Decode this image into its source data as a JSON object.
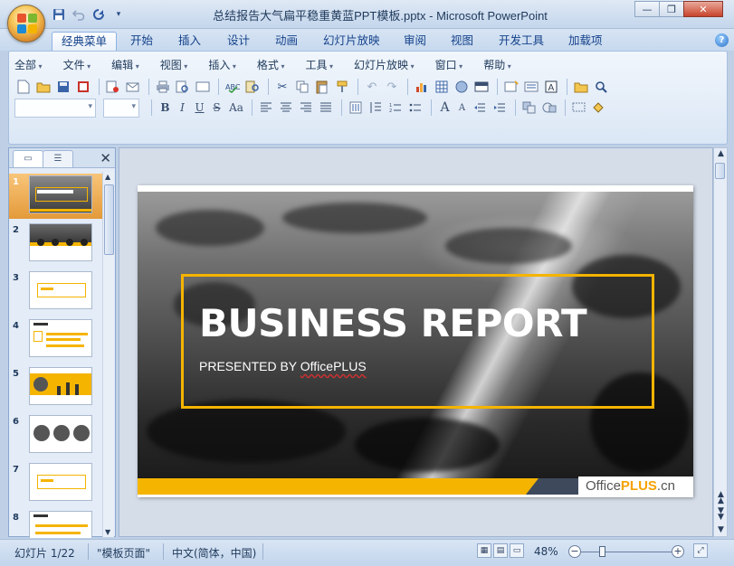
{
  "window": {
    "title": "总结报告大气扁平稳重黄蓝PPT模板.pptx - Microsoft PowerPoint",
    "minimize": "—",
    "restore": "❐",
    "close": "✕"
  },
  "quick_access": [
    "save-icon",
    "undo-icon",
    "redo-icon",
    "customize-icon"
  ],
  "ribbon_tabs": [
    "经典菜单",
    "开始",
    "插入",
    "设计",
    "动画",
    "幻灯片放映",
    "审阅",
    "视图",
    "开发工具",
    "加载项"
  ],
  "active_tab": "经典菜单",
  "help": "?",
  "classic_menu": [
    "全部",
    "文件",
    "编辑",
    "视图",
    "插入",
    "格式",
    "工具",
    "幻灯片放映",
    "窗口",
    "帮助"
  ],
  "toolbar_glyphs": {
    "new": "🗋",
    "open": "📂",
    "save": "💾",
    "print": "🖶",
    "cut": "✂",
    "copy": "⎘",
    "paste": "📋",
    "undo": "↶",
    "redo": "↷",
    "find": "🔍"
  },
  "format_buttons": {
    "bold": "B",
    "italic": "I",
    "underline": "U",
    "strike": "S",
    "case": "Aa",
    "grow": "A",
    "shrink": "A"
  },
  "left_pane": {
    "tab_slides": "▭",
    "tab_outline": "☰",
    "close": "✕",
    "thumbnails": [
      "1",
      "2",
      "3",
      "4",
      "5",
      "6",
      "7",
      "8"
    ],
    "selected": 1
  },
  "slide": {
    "title": "BUSINESS REPORT",
    "subtitle_prefix": "PRESENTED BY ",
    "subtitle_brand": "OfficePLUS",
    "logo_office": "Office",
    "logo_plus": "PLUS",
    "logo_cn": ".cn"
  },
  "status": {
    "slide_info": "幻灯片 1/22",
    "theme": "\"模板页面\"",
    "language": "中文(简体，中国)",
    "zoom": "48%",
    "zoom_out": "−",
    "zoom_in": "+"
  },
  "colors": {
    "accent_yellow": "#f5b400",
    "ribbon_blue": "#15428b",
    "logo_dark": "#3e4a5c"
  }
}
